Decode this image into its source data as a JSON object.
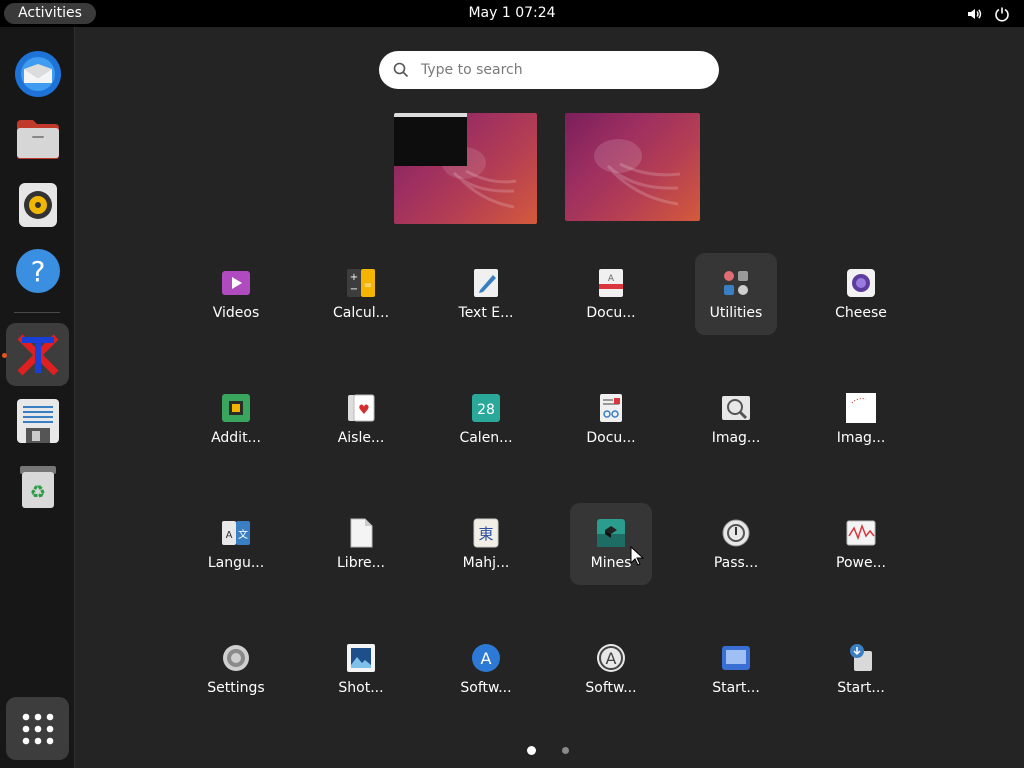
{
  "topbar": {
    "activities_label": "Activities",
    "clock": "May 1  07:24",
    "tray_icons": [
      "volume-icon",
      "power-icon"
    ]
  },
  "dock": {
    "items": [
      {
        "name": "thunderbird-icon"
      },
      {
        "name": "files-icon"
      },
      {
        "name": "rhythmbox-icon"
      },
      {
        "name": "help-icon"
      },
      {
        "name": "xterm-icon",
        "running": true,
        "active": true
      },
      {
        "name": "text-editor-icon"
      },
      {
        "name": "trash-icon"
      }
    ],
    "show_apps": "apps-grid-icon"
  },
  "search": {
    "placeholder": "Type to search"
  },
  "workspaces": [
    {
      "has_terminal_window": true
    },
    {
      "has_terminal_window": false
    }
  ],
  "apps": [
    {
      "label": "Videos",
      "icon": "videos-icon"
    },
    {
      "label": "Calcul...",
      "icon": "calculator-icon"
    },
    {
      "label": "Text E...",
      "icon": "text-editor-icon"
    },
    {
      "label": "Docu...",
      "icon": "document-viewer-icon"
    },
    {
      "label": "Utilities",
      "icon": "utilities-folder-icon"
    },
    {
      "label": "Cheese",
      "icon": "cheese-icon"
    },
    {
      "label": "Addit...",
      "icon": "additional-drivers-icon"
    },
    {
      "label": "Aisle...",
      "icon": "aisleriot-icon"
    },
    {
      "label": "Calen...",
      "icon": "calendar-icon"
    },
    {
      "label": "Docu...",
      "icon": "document-scanner-icon"
    },
    {
      "label": "Imag...",
      "icon": "image-viewer-icon"
    },
    {
      "label": "Imag...",
      "icon": "image-magick-icon"
    },
    {
      "label": "Langu...",
      "icon": "language-support-icon"
    },
    {
      "label": "Libre...",
      "icon": "libreoffice-icon"
    },
    {
      "label": "Mahj...",
      "icon": "mahjongg-icon"
    },
    {
      "label": "Mines",
      "icon": "mines-icon"
    },
    {
      "label": "Pass...",
      "icon": "passwords-icon"
    },
    {
      "label": "Powe...",
      "icon": "power-statistics-icon"
    },
    {
      "label": "Settings",
      "icon": "settings-icon"
    },
    {
      "label": "Shot...",
      "icon": "shotwell-icon"
    },
    {
      "label": "Softw...",
      "icon": "software-icon"
    },
    {
      "label": "Softw...",
      "icon": "software-updater-icon"
    },
    {
      "label": "Start...",
      "icon": "startup-disk-icon"
    },
    {
      "label": "Start...",
      "icon": "startup-applications-icon"
    }
  ],
  "calendar_day": "28",
  "mahjongg_glyph": "東",
  "language_glyphs": "A 文",
  "pager": {
    "pages": 2,
    "current": 1
  },
  "colors": {
    "accent": "#e95420",
    "background": "#242424",
    "dock": "#171717"
  }
}
